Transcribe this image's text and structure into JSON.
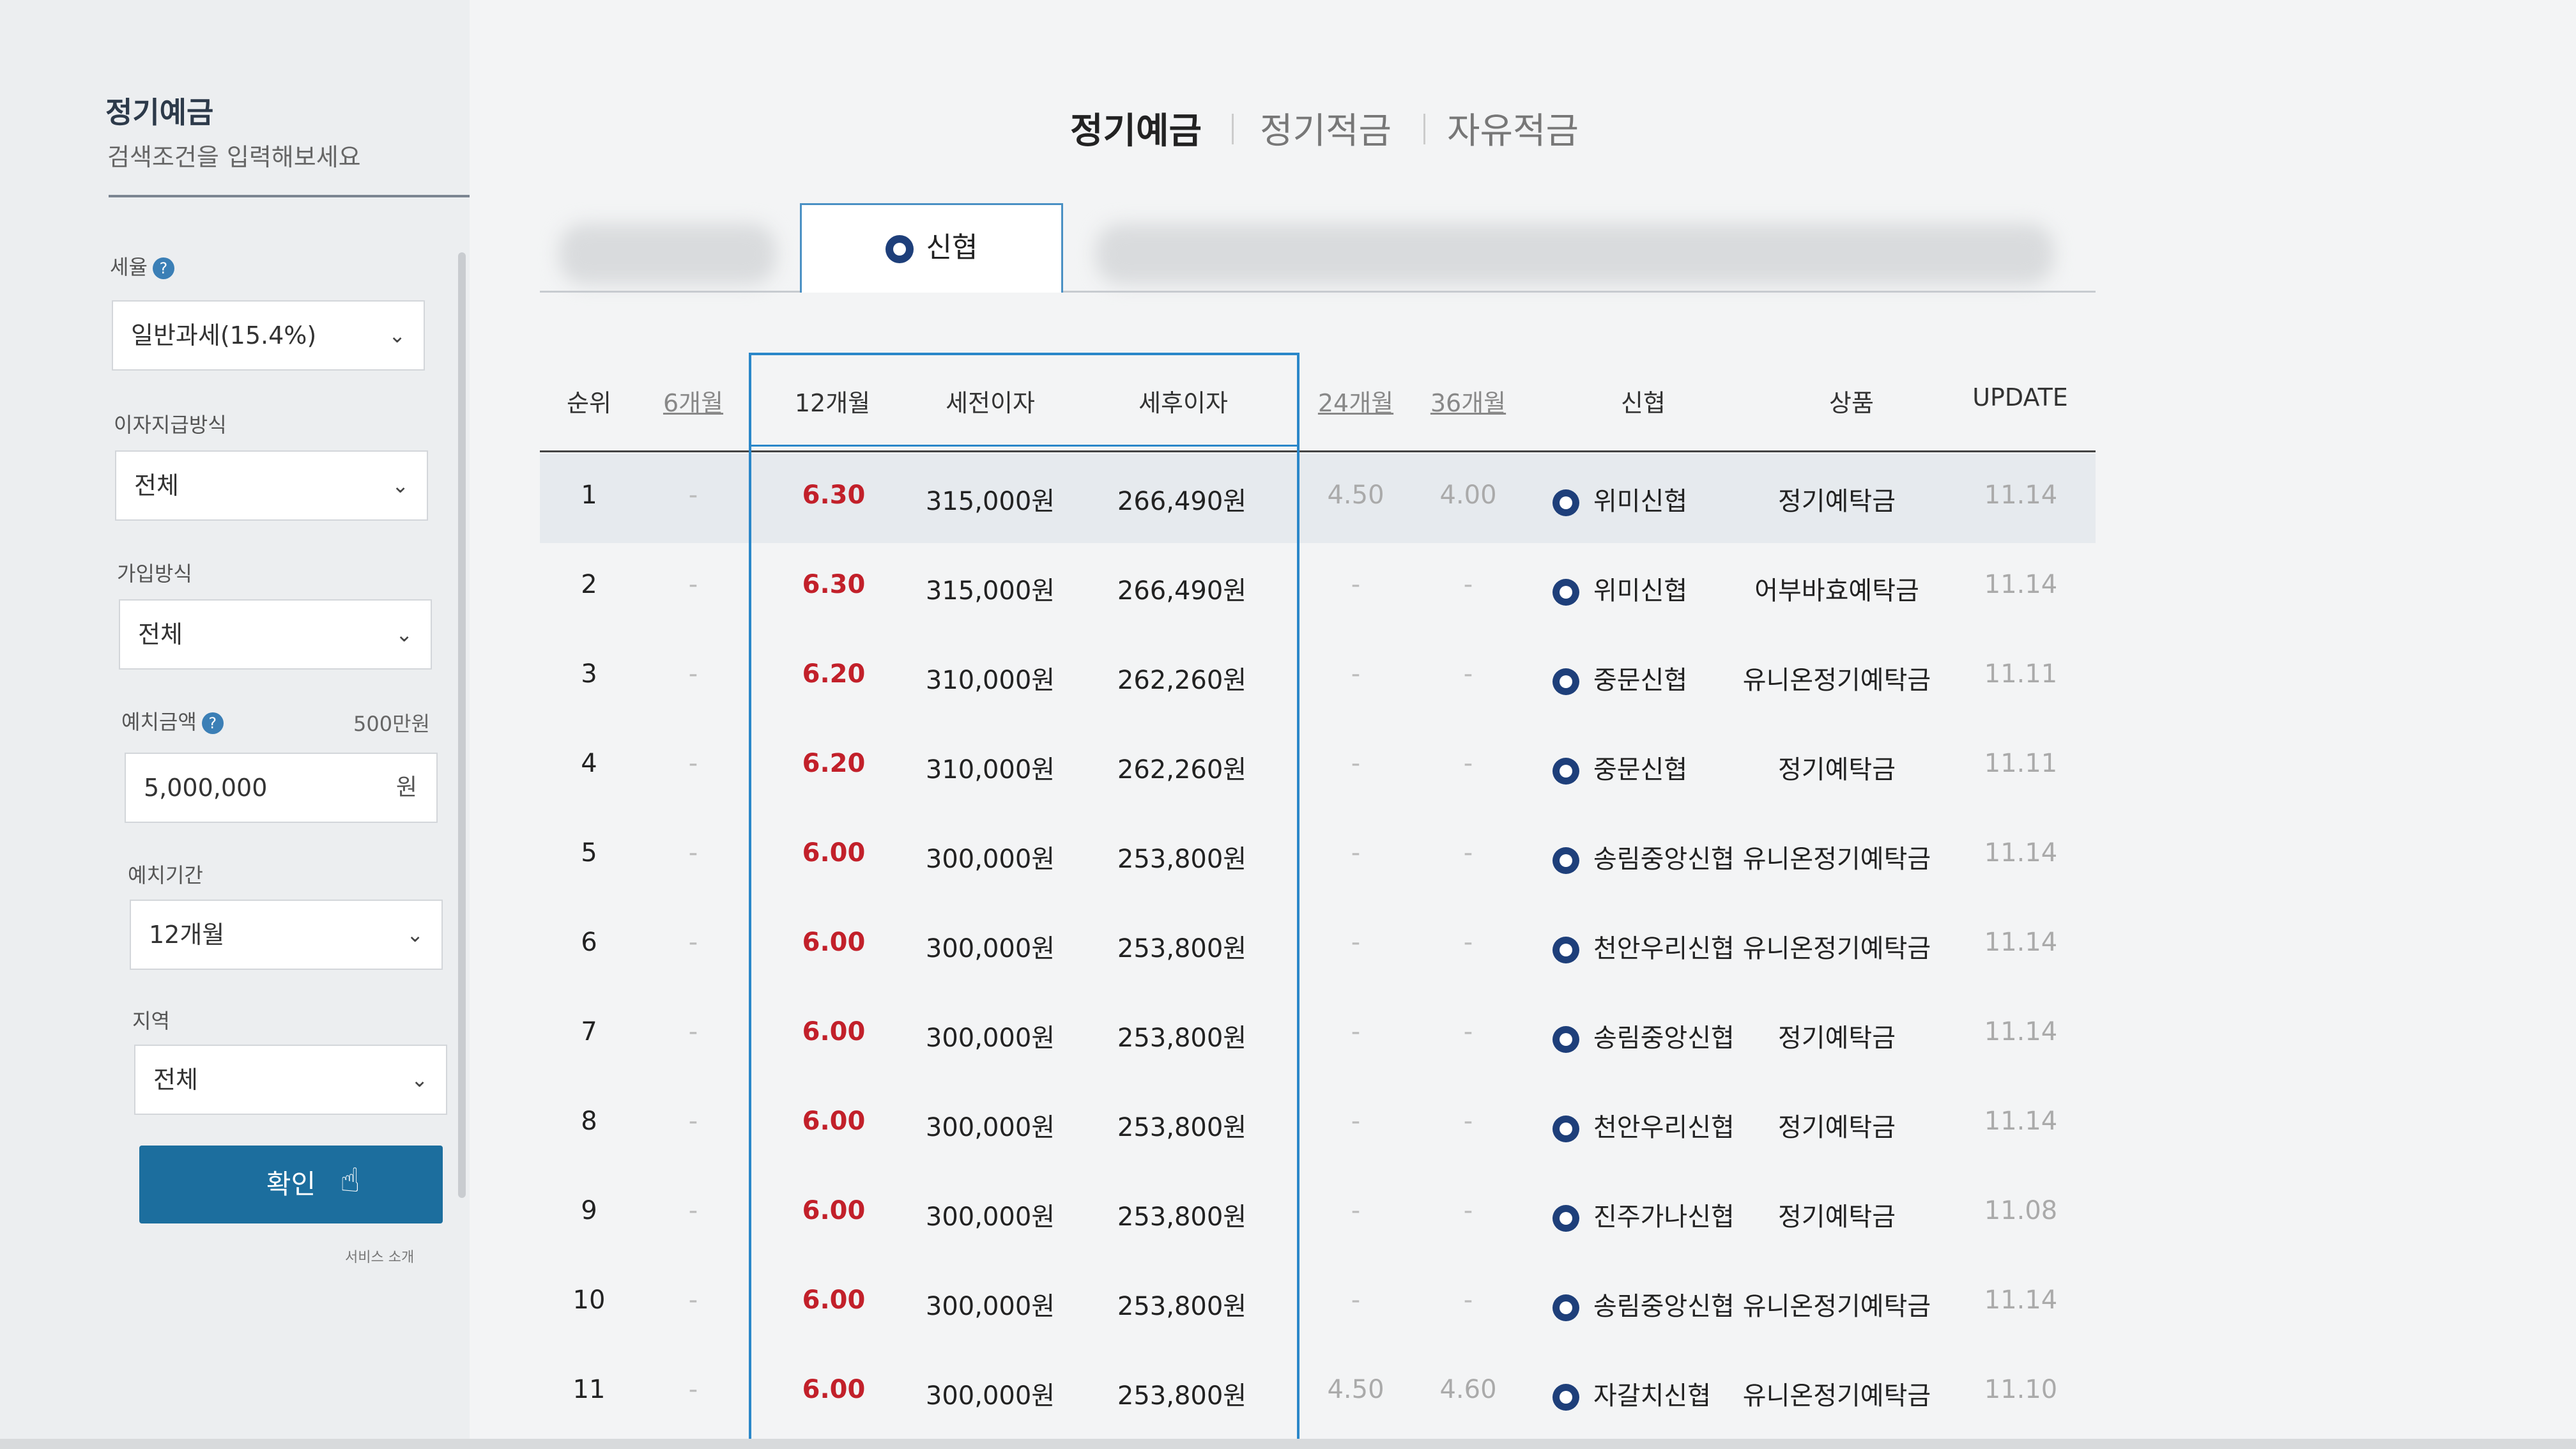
{
  "sidebar": {
    "title": "정기예금",
    "subtitle": "검색조건을 입력해보세요",
    "tax": {
      "label": "세율",
      "help": "?",
      "value": "일반과세(15.4%)"
    },
    "interest_method": {
      "label": "이자지급방식",
      "value": "전체"
    },
    "join_method": {
      "label": "가입방식",
      "value": "전체"
    },
    "amount": {
      "label": "예치금액",
      "help": "?",
      "hint": "500만원",
      "value": "5,000,000",
      "unit": "원"
    },
    "period": {
      "label": "예치기간",
      "value": "12개월"
    },
    "region": {
      "label": "지역",
      "value": "전체"
    },
    "confirm_label": "확인",
    "footer_text": "서비스 소개"
  },
  "product_tabs": [
    "정기예금",
    "정기적금",
    "자유적금"
  ],
  "bank_tab": {
    "label": "신협"
  },
  "table": {
    "headers": {
      "rank": "순위",
      "m6": "6개월",
      "m12": "12개월",
      "pre_tax": "세전이자",
      "after_tax": "세후이자",
      "m24": "24개월",
      "m36": "36개월",
      "bank": "신협",
      "product": "상품",
      "update": "UPDATE"
    },
    "rows": [
      {
        "rank": "1",
        "m6": "-",
        "m12": "6.30",
        "pre": "315,000원",
        "post": "266,490원",
        "m24": "4.50",
        "m36": "4.00",
        "bank": "위미신협",
        "product": "정기예탁금",
        "update": "11.14"
      },
      {
        "rank": "2",
        "m6": "-",
        "m12": "6.30",
        "pre": "315,000원",
        "post": "266,490원",
        "m24": "-",
        "m36": "-",
        "bank": "위미신협",
        "product": "어부바효예탁금",
        "update": "11.14"
      },
      {
        "rank": "3",
        "m6": "-",
        "m12": "6.20",
        "pre": "310,000원",
        "post": "262,260원",
        "m24": "-",
        "m36": "-",
        "bank": "중문신협",
        "product": "유니온정기예탁금",
        "update": "11.11"
      },
      {
        "rank": "4",
        "m6": "-",
        "m12": "6.20",
        "pre": "310,000원",
        "post": "262,260원",
        "m24": "-",
        "m36": "-",
        "bank": "중문신협",
        "product": "정기예탁금",
        "update": "11.11"
      },
      {
        "rank": "5",
        "m6": "-",
        "m12": "6.00",
        "pre": "300,000원",
        "post": "253,800원",
        "m24": "-",
        "m36": "-",
        "bank": "송림중앙신협",
        "product": "유니온정기예탁금",
        "update": "11.14"
      },
      {
        "rank": "6",
        "m6": "-",
        "m12": "6.00",
        "pre": "300,000원",
        "post": "253,800원",
        "m24": "-",
        "m36": "-",
        "bank": "천안우리신협",
        "product": "유니온정기예탁금",
        "update": "11.14"
      },
      {
        "rank": "7",
        "m6": "-",
        "m12": "6.00",
        "pre": "300,000원",
        "post": "253,800원",
        "m24": "-",
        "m36": "-",
        "bank": "송림중앙신협",
        "product": "정기예탁금",
        "update": "11.14"
      },
      {
        "rank": "8",
        "m6": "-",
        "m12": "6.00",
        "pre": "300,000원",
        "post": "253,800원",
        "m24": "-",
        "m36": "-",
        "bank": "천안우리신협",
        "product": "정기예탁금",
        "update": "11.14"
      },
      {
        "rank": "9",
        "m6": "-",
        "m12": "6.00",
        "pre": "300,000원",
        "post": "253,800원",
        "m24": "-",
        "m36": "-",
        "bank": "진주가나신협",
        "product": "정기예탁금",
        "update": "11.08"
      },
      {
        "rank": "10",
        "m6": "-",
        "m12": "6.00",
        "pre": "300,000원",
        "post": "253,800원",
        "m24": "-",
        "m36": "-",
        "bank": "송림중앙신협",
        "product": "유니온정기예탁금",
        "update": "11.14"
      },
      {
        "rank": "11",
        "m6": "-",
        "m12": "6.00",
        "pre": "300,000원",
        "post": "253,800원",
        "m24": "4.50",
        "m36": "4.60",
        "bank": "자갈치신협",
        "product": "유니온정기예탁금",
        "update": "11.10"
      }
    ]
  },
  "colors": {
    "accent": "#2a87c9",
    "rate": "#c2202a",
    "confirm": "#1c6e9e",
    "bank_logo": "#1e3f7a"
  },
  "icons": {
    "help": "help-circle-icon",
    "dropdown": "chevron-down-icon",
    "bank": "shinhyup-logo-icon",
    "cursor": "hand-pointer-icon"
  }
}
